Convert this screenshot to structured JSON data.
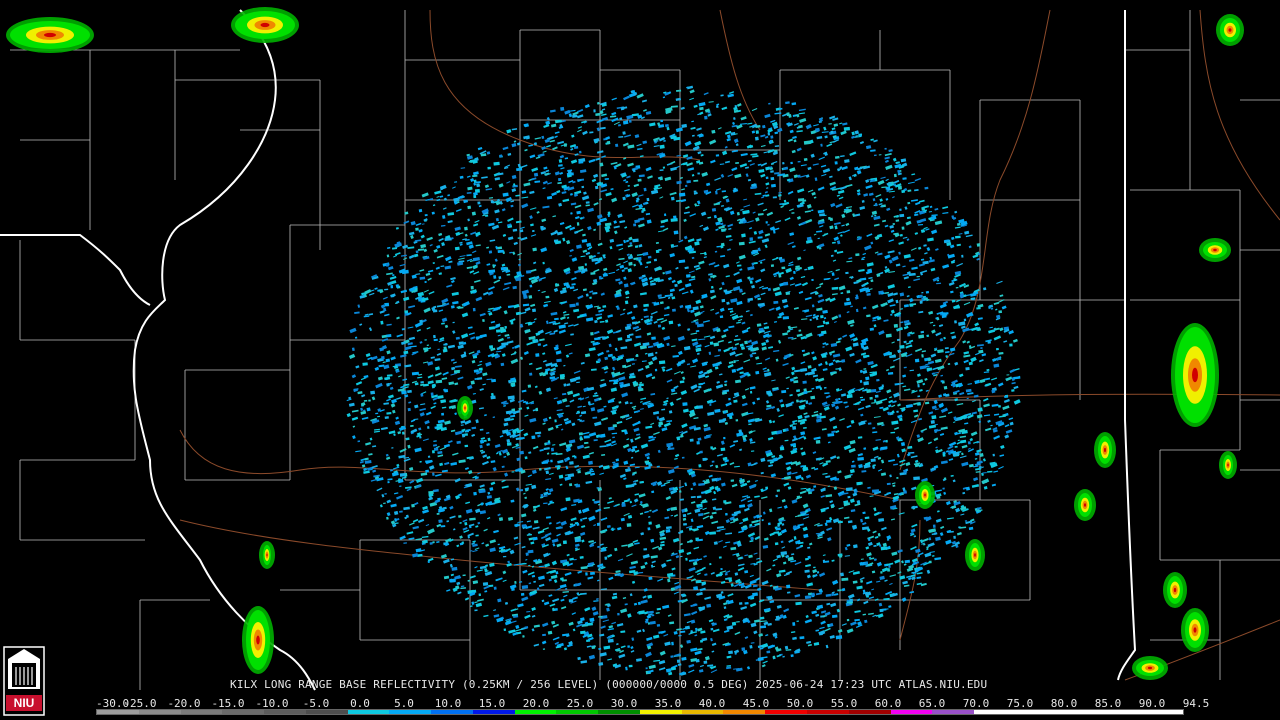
{
  "caption": "KILX LONG RANGE BASE REFLECTIVITY (0.25KM / 256 LEVEL) (000000/0000 0.5 DEG) 2025-06-24 17:23 UTC  ATLAS.NIU.EDU",
  "scale": {
    "labels": [
      "-30.0",
      "-25.0",
      "-20.0",
      "-15.0",
      "-10.0",
      "-5.0",
      "0.0",
      "5.0",
      "10.0",
      "15.0",
      "20.0",
      "25.0",
      "30.0",
      "35.0",
      "40.0",
      "45.0",
      "50.0",
      "55.0",
      "60.0",
      "65.0",
      "70.0",
      "75.0",
      "80.0",
      "85.0",
      "90.0",
      "94.5"
    ],
    "colors": [
      "#9c9c9c",
      "#8a8a8a",
      "#7a7a7a",
      "#6b6b6b",
      "#5c5c5c",
      "#4d4d4d",
      "#0ec9e0",
      "#04a9f4",
      "#0070f0",
      "#0018e8",
      "#00f000",
      "#00c800",
      "#009000",
      "#f0f000",
      "#e8b800",
      "#f08800",
      "#f00000",
      "#c80000",
      "#a00000",
      "#f000f0",
      "#9850c8",
      "#ffffff",
      "#ffffff",
      "#ffffff",
      "#ffffff",
      "#ffffff"
    ]
  },
  "logo": {
    "text": "NIU",
    "icon": "niu-tower-logo"
  },
  "colors": {
    "background": "#000000",
    "county_lines": "#c8c8c8",
    "state_lines": "#ffffff",
    "roads": "#8b4a2a"
  }
}
